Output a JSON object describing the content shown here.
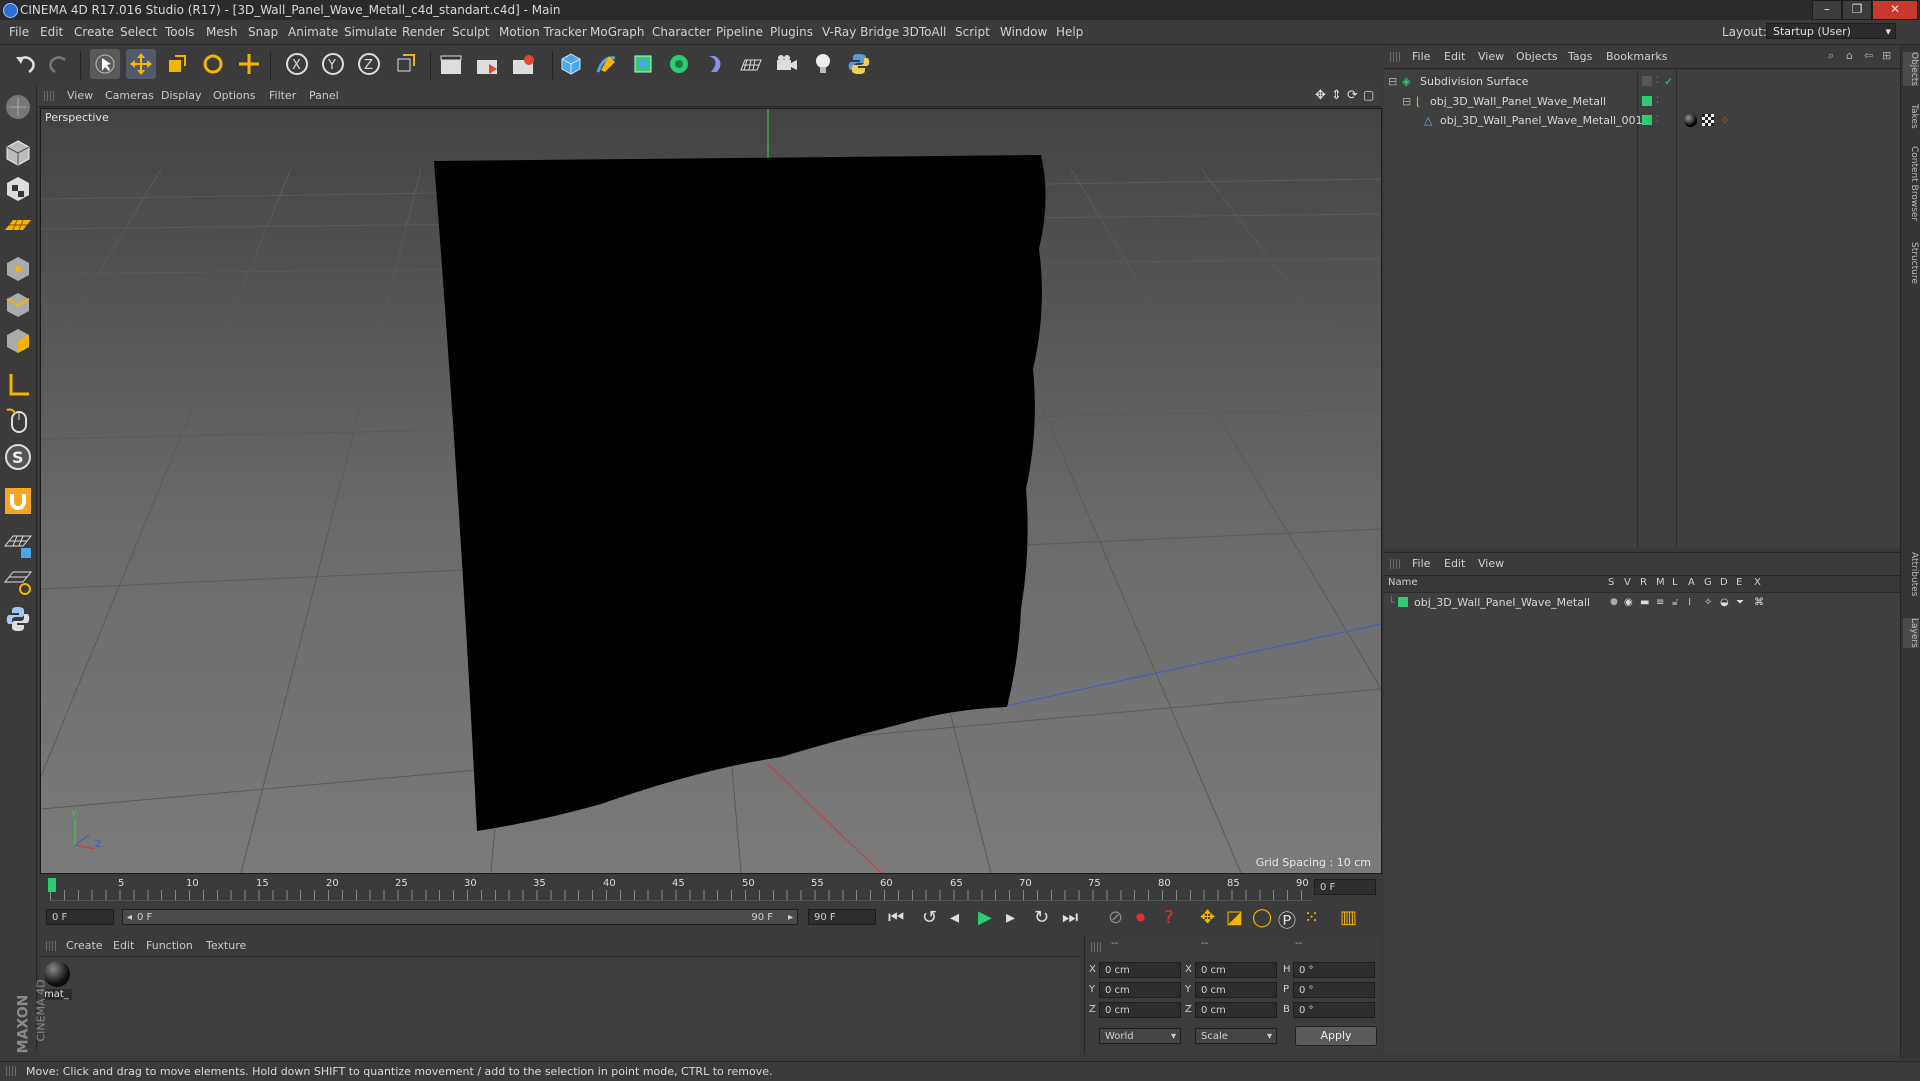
{
  "window": {
    "title": "CINEMA 4D R17.016 Studio (R17) - [3D_Wall_Panel_Wave_Metall_c4d_standart.c4d] - Main",
    "minimize": "–",
    "restore": "❐",
    "close": "✕"
  },
  "menubar": {
    "items": [
      "File",
      "Edit",
      "Create",
      "Select",
      "Tools",
      "Mesh",
      "Snap",
      "Animate",
      "Simulate",
      "Render",
      "Sculpt",
      "Motion Tracker",
      "MoGraph",
      "Character",
      "Pipeline",
      "Plugins",
      "V-Ray Bridge",
      "3DToAll",
      "Script",
      "Window",
      "Help"
    ],
    "layout_label": "Layout:",
    "layout_value": "Startup (User)"
  },
  "viewport": {
    "menu": [
      "View",
      "Cameras",
      "Display",
      "Options",
      "Filter",
      "Panel"
    ],
    "label": "Perspective",
    "grid_spacing": "Grid Spacing : 10 cm"
  },
  "timeline": {
    "ticks": [
      "0",
      "5",
      "10",
      "15",
      "20",
      "25",
      "30",
      "35",
      "40",
      "45",
      "50",
      "55",
      "60",
      "65",
      "70",
      "75",
      "80",
      "85",
      "90"
    ],
    "current_frame": "0 F",
    "start_field": "0 F",
    "range_start": "0 F",
    "range_end": "90 F",
    "end_field": "90 F"
  },
  "materials": {
    "menu": [
      "Create",
      "Edit",
      "Function",
      "Texture"
    ],
    "items": [
      {
        "name": "mat_"
      }
    ]
  },
  "coordinates": {
    "headers": [
      "--",
      "--",
      "--"
    ],
    "rows": [
      {
        "a_label": "X",
        "a_value": "0 cm",
        "b_label": "X",
        "b_value": "0 cm",
        "c_label": "H",
        "c_value": "0 °"
      },
      {
        "a_label": "Y",
        "a_value": "0 cm",
        "b_label": "Y",
        "b_value": "0 cm",
        "c_label": "P",
        "c_value": "0 °"
      },
      {
        "a_label": "Z",
        "a_value": "0 cm",
        "b_label": "Z",
        "b_value": "0 cm",
        "c_label": "B",
        "c_value": "0 °"
      }
    ],
    "mode_world": "World",
    "mode_scale": "Scale",
    "apply": "Apply"
  },
  "object_manager": {
    "menu": [
      "File",
      "Edit",
      "View",
      "Objects",
      "Tags",
      "Bookmarks"
    ],
    "objects": [
      {
        "name": "Subdivision Surface"
      },
      {
        "name": "obj_3D_Wall_Panel_Wave_Metall"
      },
      {
        "name": "obj_3D_Wall_Panel_Wave_Metall_001"
      }
    ]
  },
  "layer_manager": {
    "menu": [
      "File",
      "Edit",
      "View"
    ],
    "columns": [
      "Name",
      "S",
      "V",
      "R",
      "M",
      "L",
      "A",
      "G",
      "D",
      "E",
      "X"
    ],
    "layers": [
      {
        "name": "obj_3D_Wall_Panel_Wave_Metall",
        "color": "#2ecc71"
      }
    ]
  },
  "right_tabs": [
    "Objects",
    "Takes",
    "Content Browser",
    "Structure",
    "Attributes",
    "Layers"
  ],
  "branding": {
    "maxon": "MAXON",
    "product": "CINEMA 4D"
  },
  "status": "Move: Click and drag to move elements. Hold down SHIFT to quantize movement / add to the selection in point mode, CTRL to remove.",
  "colors": {
    "accent": "#2ecc71",
    "x_axis": "#d23a3a",
    "y_axis": "#3ad23a",
    "z_axis": "#3a5ad2"
  }
}
